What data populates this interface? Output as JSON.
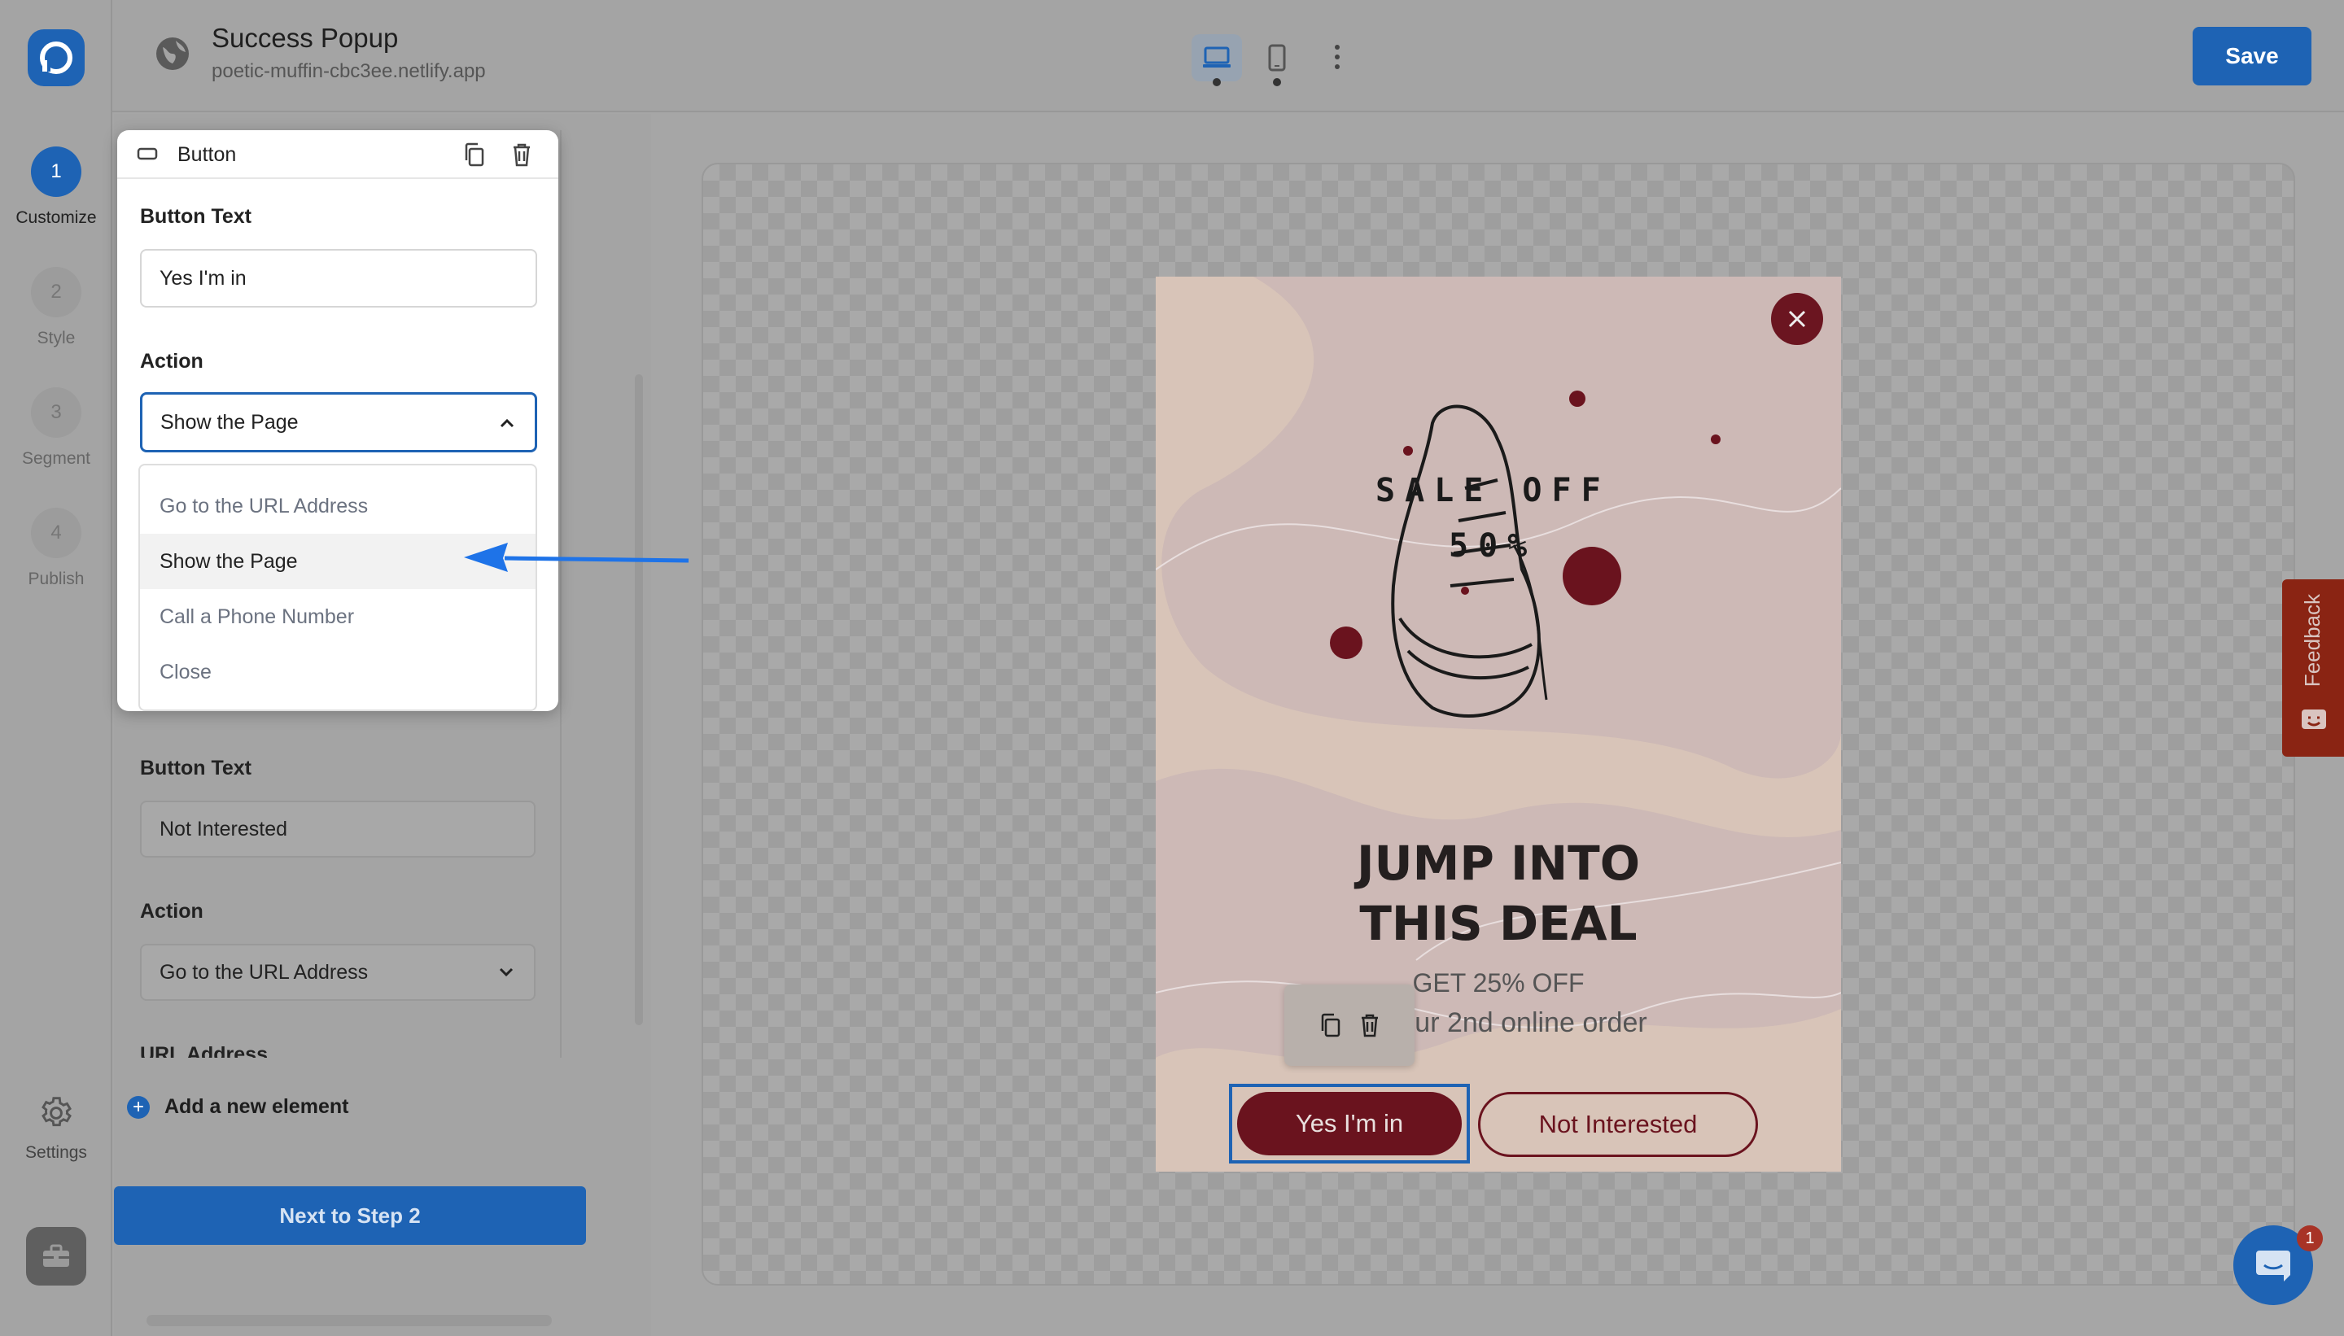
{
  "app": {
    "title": "Success Popup",
    "url": "poetic-muffin-cbc3ee.netlify.app",
    "save_label": "Save"
  },
  "steps": [
    {
      "number": "1",
      "label": "Customize",
      "active": true
    },
    {
      "number": "2",
      "label": "Style"
    },
    {
      "number": "3",
      "label": "Segment"
    },
    {
      "number": "4",
      "label": "Publish"
    }
  ],
  "rail": {
    "settings_label": "Settings"
  },
  "element_card": {
    "header_label": "Button",
    "button_text_label": "Button Text",
    "button_text_value": "Yes I'm in",
    "action_label": "Action",
    "action_value": "Show the Page",
    "options": [
      "Go to the URL Address",
      "Show the Page",
      "Call a Phone Number",
      "Close"
    ],
    "selected_option": "Show the Page"
  },
  "second_button": {
    "button_text_label": "Button Text",
    "button_text_value": "Not Interested",
    "action_label": "Action",
    "action_value": "Go to the URL Address",
    "url_label": "URL Address"
  },
  "panel": {
    "add_element_label": "Add a new element",
    "next_label": "Next to Step 2"
  },
  "popup": {
    "sale_line1": "SALE OFF",
    "sale_line2": "50%",
    "headline_line1": "JUMP INTO",
    "headline_line2": "THIS DEAL",
    "sub_line1": "GET 25% OFF",
    "sub_line2": "ur 2nd online order",
    "yes_button": "Yes I'm in",
    "no_button": "Not Interested"
  },
  "feedback_label": "Feedback",
  "chat_badge": "1",
  "colors": {
    "accent": "#1e63b4",
    "brand_dark_red": "#6a131e",
    "feedback": "#8a2413"
  }
}
